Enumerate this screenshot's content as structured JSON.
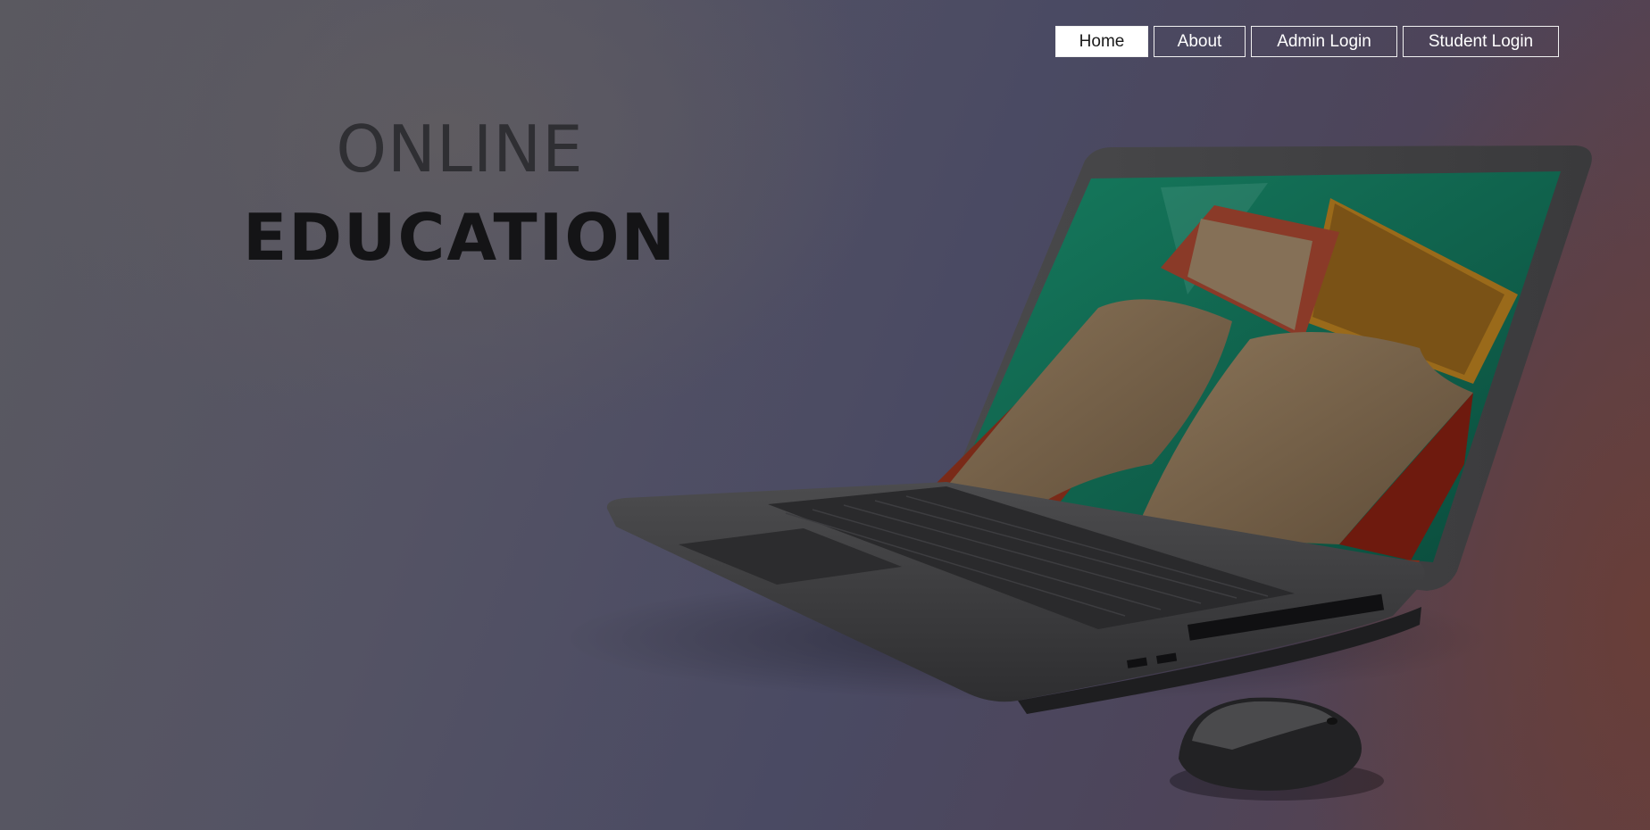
{
  "nav": {
    "items": [
      {
        "label": "Home",
        "active": true
      },
      {
        "label": "About",
        "active": false
      },
      {
        "label": "Admin Login",
        "active": false
      },
      {
        "label": "Student Login",
        "active": false
      }
    ]
  },
  "hero": {
    "line1": "ONLINE",
    "line2": "EDUCATION"
  },
  "illustration": {
    "subject": "laptop-with-books-on-screen-and-mouse",
    "screen_color": "#0f6a52"
  },
  "colors": {
    "background_left": "#56555f",
    "background_mid": "#4a4a63",
    "background_right": "#5e4048",
    "nav_border": "#f1f1f1",
    "nav_active_bg": "#ffffff"
  }
}
